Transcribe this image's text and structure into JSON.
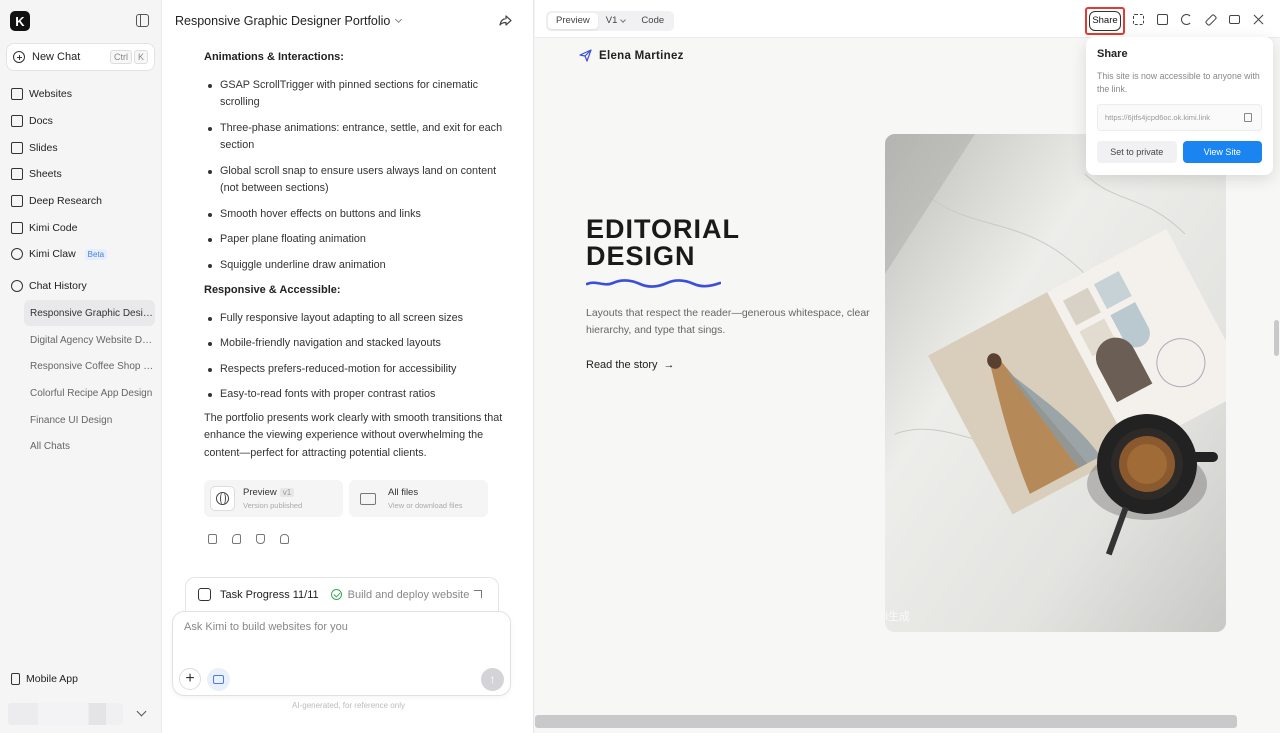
{
  "sidebar": {
    "logo": "K",
    "new_chat": "New Chat",
    "shortcut": [
      "Ctrl",
      "K"
    ],
    "nav": [
      {
        "label": "Websites",
        "icon": "websites-icon"
      },
      {
        "label": "Docs",
        "icon": "docs-icon"
      },
      {
        "label": "Slides",
        "icon": "slides-icon"
      },
      {
        "label": "Sheets",
        "icon": "sheets-icon"
      },
      {
        "label": "Deep Research",
        "icon": "deep-research-icon"
      },
      {
        "label": "Kimi Code",
        "icon": "kimi-code-icon"
      },
      {
        "label": "Kimi Claw",
        "icon": "kimi-claw-icon",
        "badge": "Beta"
      }
    ],
    "chat_history_label": "Chat History",
    "history": [
      "Responsive Graphic Design...",
      "Digital Agency Website De...",
      "Responsive Coffee Shop W...",
      "Colorful Recipe App Design",
      "Finance UI Design",
      "All Chats"
    ],
    "mobile_app": "Mobile App"
  },
  "chat": {
    "title": "Responsive Graphic Designer Portfolio",
    "section1_title": "Animations & Interactions:",
    "section1_items": [
      "GSAP ScrollTrigger with pinned sections for cinematic scrolling",
      "Three-phase animations: entrance, settle, and exit for each section",
      "Global scroll snap to ensure users always land on content (not between sections)",
      "Smooth hover effects on buttons and links",
      "Paper plane floating animation",
      "Squiggle underline draw animation"
    ],
    "section2_title": "Responsive & Accessible:",
    "section2_items": [
      "Fully responsive layout adapting to all screen sizes",
      "Mobile-friendly navigation and stacked layouts",
      "Respects prefers-reduced-motion for accessibility",
      "Easy-to-read fonts with proper contrast ratios"
    ],
    "summary": "The portfolio presents work clearly with smooth transitions that enhance the viewing experience without overwhelming the content—perfect for attracting potential clients.",
    "card_preview_title": "Preview",
    "card_preview_version": "v1",
    "card_preview_sub": "Version published",
    "card_files_title": "All files",
    "card_files_sub": "View or download files",
    "task_label": "Task Progress 11/11",
    "task_status": "Build and deploy website",
    "input_placeholder": "Ask Kimi to build websites for you",
    "disclaimer": "AI-generated, for reference only"
  },
  "preview": {
    "tabs": [
      "Preview",
      "V1",
      "Code"
    ],
    "share_label": "Share",
    "site": {
      "brand": "Elena Martinez",
      "hero_line1": "EDITORIAL",
      "hero_line2": "DESIGN",
      "hero_sub": "Layouts that respect the reader—generous whitespace, clear hierarchy, and type that sings.",
      "cta": "Read the story",
      "watermark": "I生成"
    },
    "share_popup": {
      "title": "Share",
      "description": "This site is now accessible to anyone with the link.",
      "link": "https://6jtfs4jcpd6oc.ok.kimi.link",
      "set_private": "Set to private",
      "view_site": "View Site"
    }
  },
  "colors": {
    "accent": "#1a84f0",
    "highlight": "#e53935",
    "squiggle": "#3b4fd8"
  }
}
